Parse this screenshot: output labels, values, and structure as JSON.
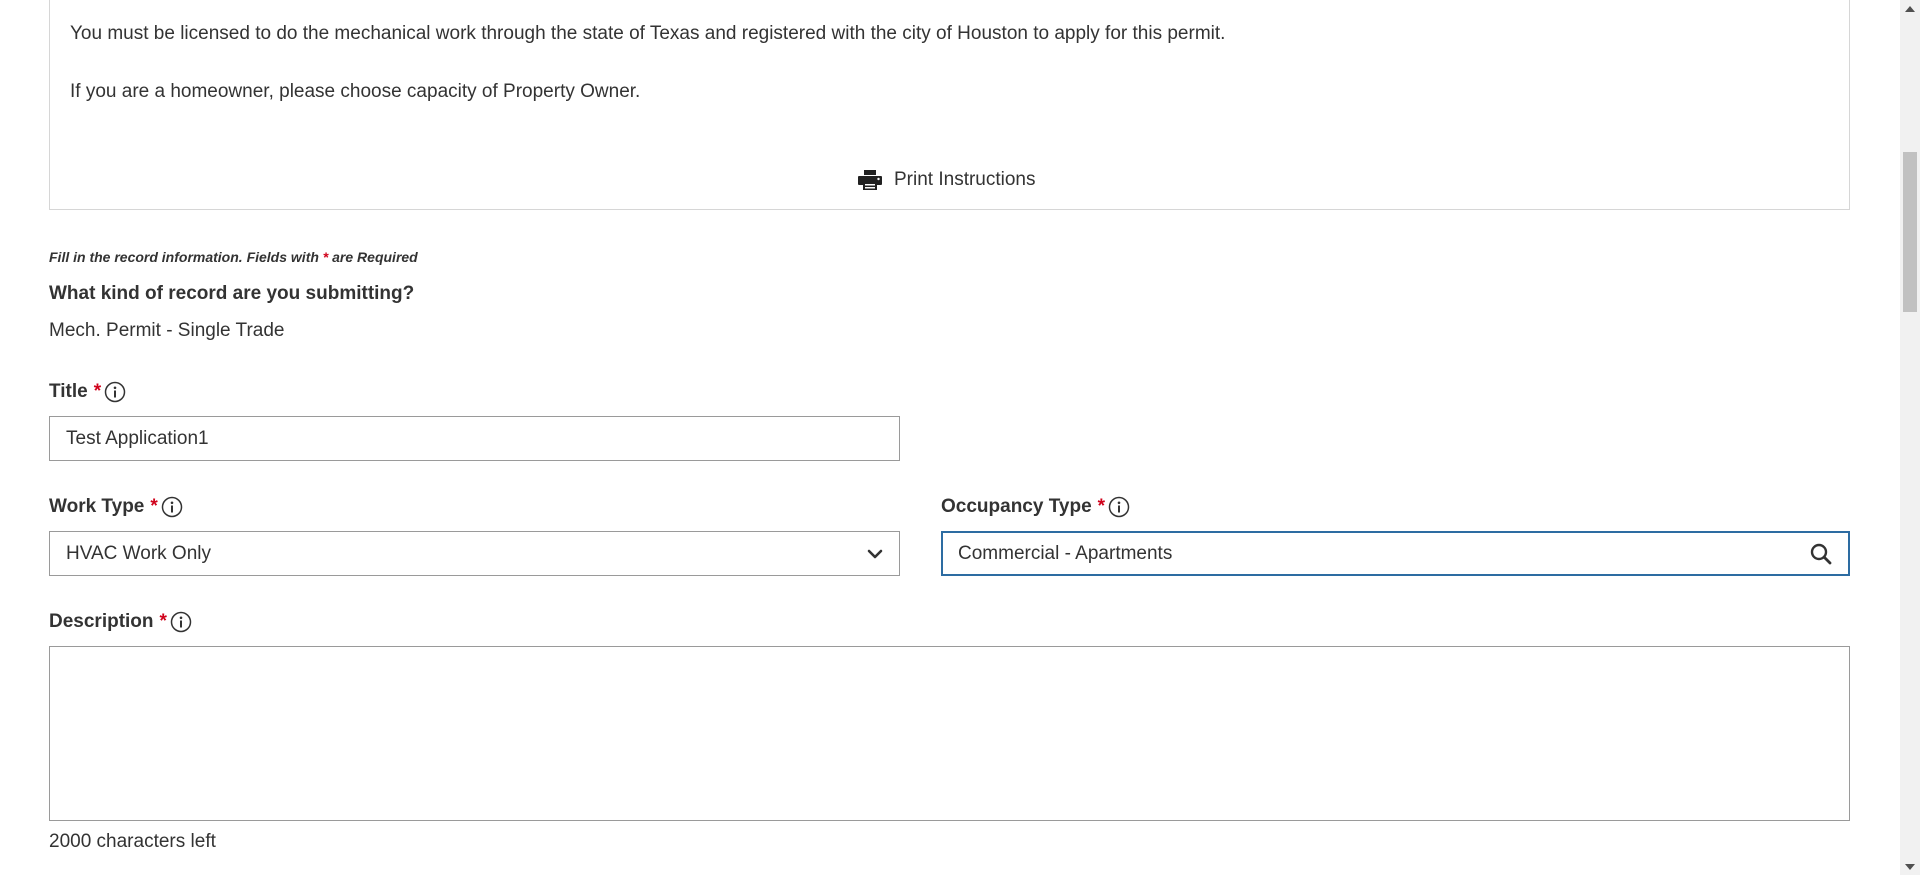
{
  "instructions": {
    "paragraph1": "You must be licensed to do the mechanical work through the state of Texas and registered with the city of Houston to apply for this permit.",
    "paragraph2": "If you are a homeowner, please choose capacity of Property Owner.",
    "print_label": "Print Instructions"
  },
  "form": {
    "hint_prefix": "Fill in the record information. Fields with",
    "hint_star": "*",
    "hint_suffix": "are Required",
    "record_question": "What kind of record are you submitting?",
    "record_value": "Mech. Permit - Single Trade",
    "title": {
      "label": "Title",
      "required": "*",
      "value": "Test Application1"
    },
    "work_type": {
      "label": "Work Type",
      "required": "*",
      "value": "HVAC Work Only"
    },
    "occupancy_type": {
      "label": "Occupancy Type",
      "required": "*",
      "value": "Commercial - Apartments"
    },
    "description": {
      "label": "Description",
      "required": "*",
      "value": "",
      "chars_left": "2000 characters left"
    }
  },
  "icons": {
    "print": "printer-icon",
    "info": "info-circle-icon",
    "dropdown": "chevron-down-icon",
    "search": "search-icon"
  },
  "colors": {
    "required": "#d0021b",
    "focus_border": "#2d6ca2",
    "text": "#333333"
  }
}
